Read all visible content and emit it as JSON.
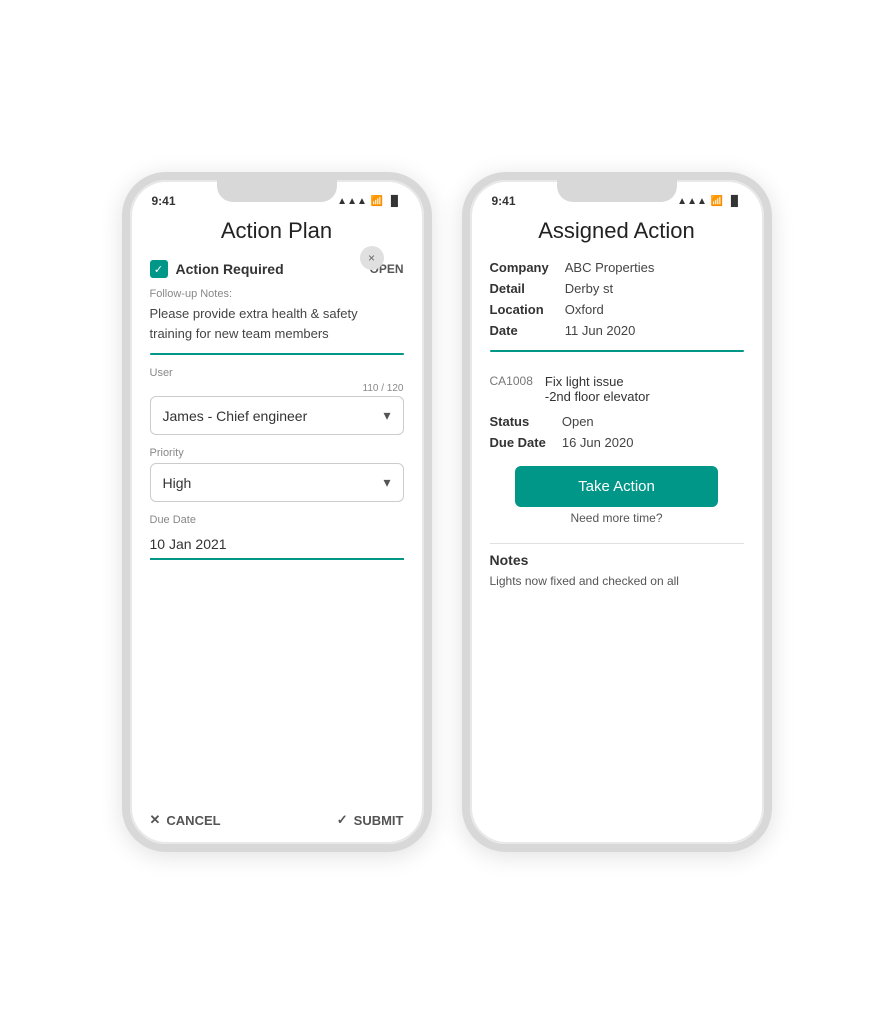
{
  "page": {
    "background": "#f0f0f0"
  },
  "phone_left": {
    "status": {
      "time": "9:41",
      "signal": "▲▲▲",
      "wifi": "WiFi",
      "battery": "🔋"
    },
    "title": "Action Plan",
    "close_icon": "×",
    "action_required": {
      "label": "Action Required",
      "status": "OPEN"
    },
    "followup_label": "Follow-up Notes:",
    "notes_text": "Please provide extra health & safety training for new team members",
    "user_label": "User",
    "char_count": "110 / 120",
    "user_value": "James  -  Chief engineer",
    "priority_label": "Priority",
    "priority_value": "High",
    "due_date_label": "Due Date",
    "due_date_value": "10 Jan 2021",
    "cancel_label": "CANCEL",
    "submit_label": "SUBMIT"
  },
  "phone_right": {
    "status": {
      "time": "9:41",
      "signal": "▲▲▲",
      "wifi": "WiFi",
      "battery": "🔋"
    },
    "title": "Assigned Action",
    "company_key": "Company",
    "company_value": "ABC Properties",
    "detail_key": "Detail",
    "detail_value": "Derby st",
    "location_key": "Location",
    "location_value": "Oxford",
    "date_key": "Date",
    "date_value": "11 Jun 2020",
    "action_code": "CA1008",
    "action_desc": "Fix light issue\n-2nd floor elevator",
    "status_key": "Status",
    "status_value": "Open",
    "due_date_key": "Due Date",
    "due_date_value": "16 Jun 2020",
    "take_action_label": "Take Action",
    "need_more_time": "Need more time?",
    "notes_title": "Notes",
    "notes_text": "Lights now fixed and checked on all"
  }
}
